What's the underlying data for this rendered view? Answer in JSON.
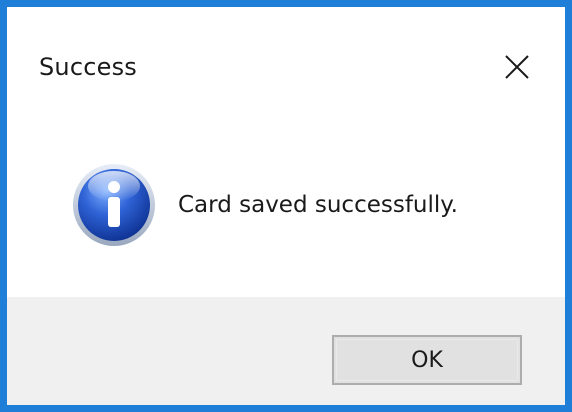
{
  "window": {
    "title": "Success"
  },
  "icons": {
    "close": "close-icon",
    "info": "information-icon"
  },
  "message": {
    "text": "Card saved successfully."
  },
  "buttons": {
    "ok_label": "OK"
  },
  "colors": {
    "frame_border": "#1e7ed8",
    "footer_bg": "#f0f0f0",
    "button_bg": "#e1e1e1",
    "button_border": "#adadad",
    "info_icon_blue": "#1e4fb5"
  }
}
